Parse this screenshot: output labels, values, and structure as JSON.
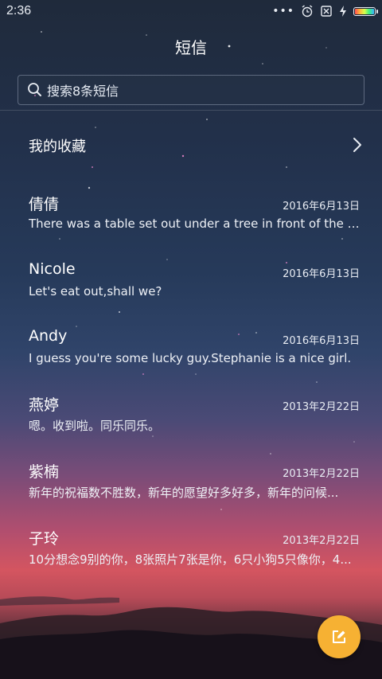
{
  "status_bar": {
    "time": "2:36",
    "more_dots": "•••",
    "icons": [
      "dots-icon",
      "alarm-icon",
      "no-sim-icon",
      "charging-icon",
      "battery-icon"
    ],
    "battery_colors": [
      "#ff4f4f",
      "#ffb43c",
      "#d8ff4a",
      "#3cf080",
      "#38b4ff"
    ]
  },
  "header": {
    "title": "短信"
  },
  "search": {
    "placeholder": "搜索8条短信",
    "icon": "search-icon"
  },
  "favorites": {
    "label": "我的收藏",
    "icon": "chevron-right-icon"
  },
  "threads": [
    {
      "name": "倩倩",
      "date": "2016年6月13日",
      "preview": "There was a table set out under a tree in front of the ho..."
    },
    {
      "name": "Nicole",
      "date": "2016年6月13日",
      "preview": "Let's eat out,shall we?"
    },
    {
      "name": "Andy",
      "date": "2016年6月13日",
      "preview": "I guess you're some lucky guy.Stephanie is a nice girl."
    },
    {
      "name": "燕婷",
      "date": "2013年2月22日",
      "preview": "嗯。收到啦。同乐同乐。"
    },
    {
      "name": "紫楠",
      "date": "2013年2月22日",
      "preview": "新年的祝福数不胜数，新年的愿望好多好多，新年的问候..."
    },
    {
      "name": "子玲",
      "date": "2013年2月22日",
      "preview": "10分想念9别的你，8张照片7张是你，6只小狗5只像你，4..."
    }
  ],
  "fab": {
    "icon": "compose-icon",
    "color": "#f6b133"
  }
}
